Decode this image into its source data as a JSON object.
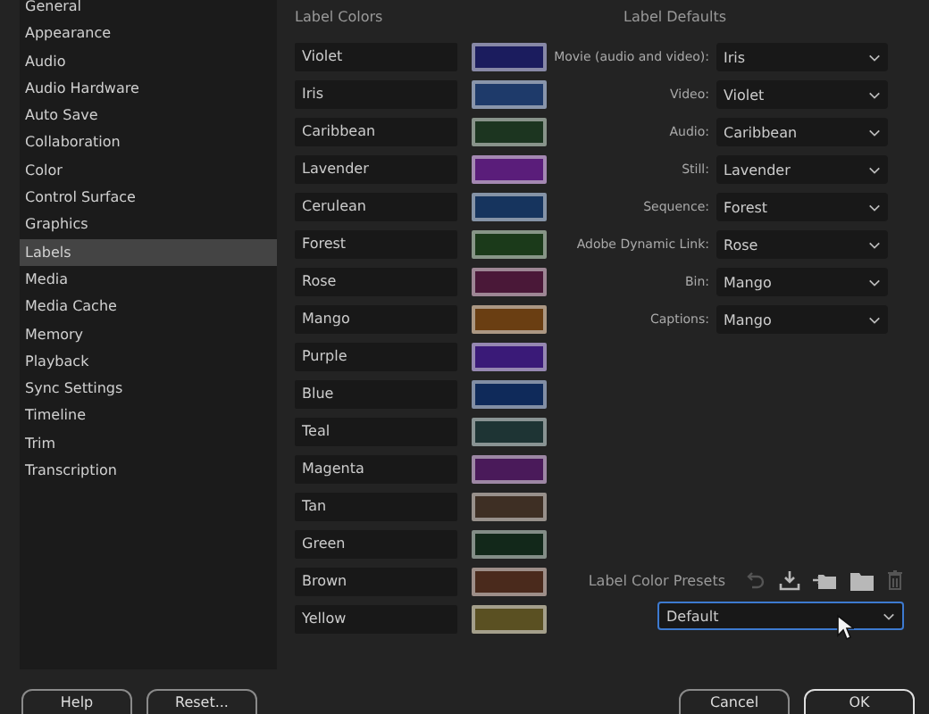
{
  "sidebar": {
    "items": [
      {
        "label": "General",
        "selected": false
      },
      {
        "label": "Appearance",
        "selected": false
      },
      {
        "label": "Audio",
        "selected": false
      },
      {
        "label": "Audio Hardware",
        "selected": false
      },
      {
        "label": "Auto Save",
        "selected": false
      },
      {
        "label": "Collaboration",
        "selected": false
      },
      {
        "label": "Color",
        "selected": false
      },
      {
        "label": "Control Surface",
        "selected": false
      },
      {
        "label": "Graphics",
        "selected": false
      },
      {
        "label": "Labels",
        "selected": true
      },
      {
        "label": "Media",
        "selected": false
      },
      {
        "label": "Media Cache",
        "selected": false
      },
      {
        "label": "Memory",
        "selected": false
      },
      {
        "label": "Playback",
        "selected": false
      },
      {
        "label": "Sync Settings",
        "selected": false
      },
      {
        "label": "Timeline",
        "selected": false
      },
      {
        "label": "Trim",
        "selected": false
      },
      {
        "label": "Transcription",
        "selected": false
      }
    ]
  },
  "label_colors": {
    "title": "Label Colors",
    "items": [
      {
        "name": "Violet",
        "color": "#1b1c5e"
      },
      {
        "name": "Iris",
        "color": "#1e3a6a"
      },
      {
        "name": "Caribbean",
        "color": "#1c3520"
      },
      {
        "name": "Lavender",
        "color": "#5a1d7a"
      },
      {
        "name": "Cerulean",
        "color": "#16345e"
      },
      {
        "name": "Forest",
        "color": "#1b3a1a"
      },
      {
        "name": "Rose",
        "color": "#4a1838"
      },
      {
        "name": "Mango",
        "color": "#6a3e12"
      },
      {
        "name": "Purple",
        "color": "#3a1a78"
      },
      {
        "name": "Blue",
        "color": "#0f2a5a"
      },
      {
        "name": "Teal",
        "color": "#1e3434"
      },
      {
        "name": "Magenta",
        "color": "#4a1a5a"
      },
      {
        "name": "Tan",
        "color": "#3e2f24"
      },
      {
        "name": "Green",
        "color": "#12281a"
      },
      {
        "name": "Brown",
        "color": "#4a2a1c"
      },
      {
        "name": "Yellow",
        "color": "#5a5022"
      }
    ]
  },
  "label_defaults": {
    "title": "Label Defaults",
    "rows": [
      {
        "label": "Movie (audio and video):",
        "value": "Iris"
      },
      {
        "label": "Video:",
        "value": "Violet"
      },
      {
        "label": "Audio:",
        "value": "Caribbean"
      },
      {
        "label": "Still:",
        "value": "Lavender"
      },
      {
        "label": "Sequence:",
        "value": "Forest"
      },
      {
        "label": "Adobe Dynamic Link:",
        "value": "Rose"
      },
      {
        "label": "Bin:",
        "value": "Mango"
      },
      {
        "label": "Captions:",
        "value": "Mango"
      }
    ]
  },
  "presets": {
    "title": "Label Color Presets",
    "tools": [
      {
        "kind": "undo",
        "disabled": true
      },
      {
        "kind": "download",
        "disabled": false
      },
      {
        "kind": "import",
        "disabled": false
      },
      {
        "kind": "folder",
        "disabled": false
      },
      {
        "kind": "trash",
        "disabled": true
      }
    ],
    "value": "Default",
    "focused": true
  },
  "buttons": {
    "left": [
      "Help",
      "Reset..."
    ],
    "right": [
      "Cancel",
      "OK"
    ]
  }
}
